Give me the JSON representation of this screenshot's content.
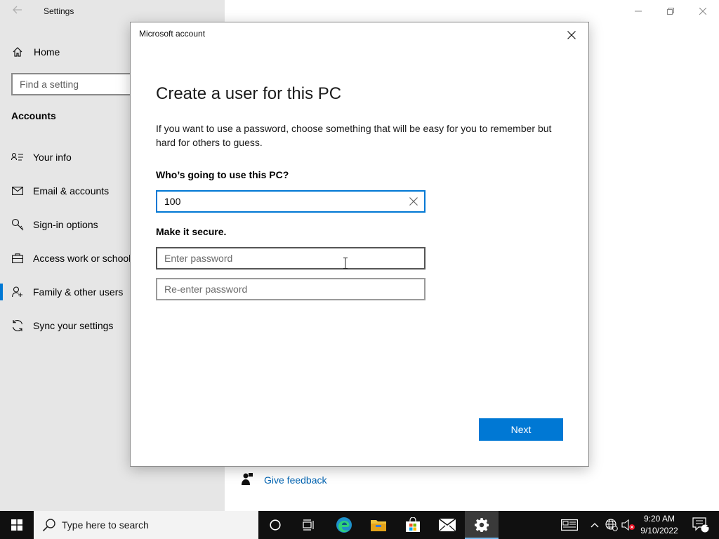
{
  "settings_window": {
    "title": "Settings",
    "home_label": "Home",
    "search_placeholder": "Find a setting",
    "section_title": "Accounts",
    "nav_items": [
      {
        "label": "Your info",
        "icon": "contact-card-icon"
      },
      {
        "label": "Email & accounts",
        "icon": "mail-icon"
      },
      {
        "label": "Sign-in options",
        "icon": "key-icon"
      },
      {
        "label": "Access work or school",
        "icon": "briefcase-icon"
      },
      {
        "label": "Family & other users",
        "icon": "person-add-icon",
        "selected": true
      },
      {
        "label": "Sync your settings",
        "icon": "sync-icon"
      }
    ],
    "feedback_label": "Give feedback"
  },
  "dialog": {
    "title": "Microsoft account",
    "heading": "Create a user for this PC",
    "description": "If you want to use a password, choose something that will be easy for you to remember but hard for others to guess.",
    "who_label": "Who’s going to use this PC?",
    "username_value": "100",
    "secure_label": "Make it secure.",
    "password_placeholder": "Enter password",
    "reenter_placeholder": "Re-enter password",
    "next_label": "Next"
  },
  "taskbar": {
    "search_placeholder": "Type here to search",
    "time": "9:20 AM",
    "date": "9/10/2022",
    "notification_count": "1"
  },
  "colors": {
    "accent": "#0078d4",
    "sidebar_bg": "#e6e6e6",
    "taskbar_bg": "#101010",
    "link": "#0063b1"
  }
}
